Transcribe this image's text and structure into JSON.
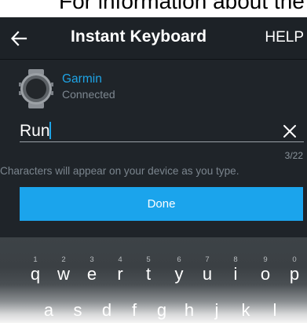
{
  "banner": {
    "text": "For information about the Garmin Connect app, see"
  },
  "toolbar": {
    "back_icon": "arrow-left-icon",
    "title": "Instant Keyboard",
    "help_label": "HELP"
  },
  "device": {
    "icon": "watch-icon",
    "name": "Garmin",
    "status": "Connected"
  },
  "input": {
    "value": "Run",
    "clear_icon": "close-icon",
    "counter": "3/22"
  },
  "helper_text": "Characters will appear on your device as you type.",
  "done_label": "Done",
  "keyboard": {
    "row1": [
      {
        "letter": "q",
        "hint": "1"
      },
      {
        "letter": "w",
        "hint": "2"
      },
      {
        "letter": "e",
        "hint": "3"
      },
      {
        "letter": "r",
        "hint": "4"
      },
      {
        "letter": "t",
        "hint": "5"
      },
      {
        "letter": "y",
        "hint": "6"
      },
      {
        "letter": "u",
        "hint": "7"
      },
      {
        "letter": "i",
        "hint": "8"
      },
      {
        "letter": "o",
        "hint": "9"
      },
      {
        "letter": "p",
        "hint": "0"
      }
    ],
    "row2": [
      "a",
      "s",
      "d",
      "f",
      "g",
      "h",
      "j",
      "k",
      "l"
    ]
  },
  "colors": {
    "accent": "#1ba4ec",
    "background": "#1f2429",
    "toolbar": "#1d2227"
  }
}
